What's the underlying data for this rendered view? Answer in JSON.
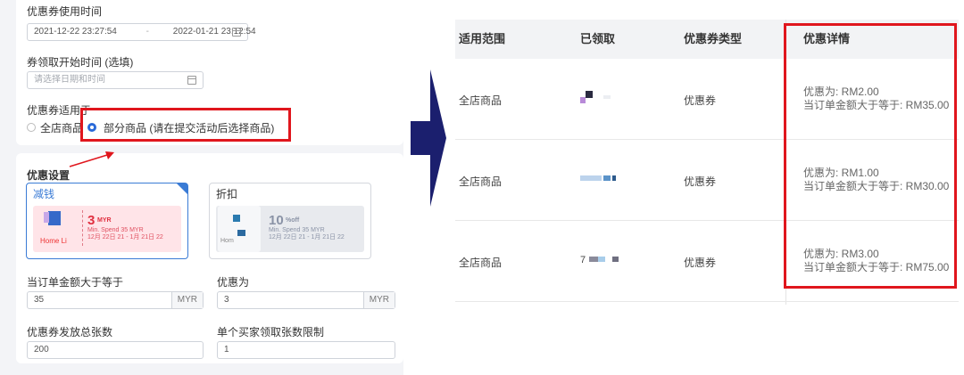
{
  "form": {
    "usage_time_label": "优惠券使用时间",
    "usage_start": "2021-12-22 23:27:54",
    "usage_sep": "-",
    "usage_end": "2022-01-21 23:12:54",
    "claim_time_label": "券领取开始时间 (选填)",
    "claim_time_placeholder": "请选择日期和时间",
    "scope_label": "优惠券适用于",
    "scope_options": [
      "全店商品",
      "部分商品 (请在提交活动后选择商品)"
    ],
    "scope_selected": 1,
    "discount_section_title": "优惠设置",
    "type_cash_label": "减钱",
    "type_percent_label": "折扣",
    "cash_voucher": {
      "amount": "3",
      "unit": "MYR",
      "min_spend": "Min. Spend 35 MYR",
      "validity": "12月 22日 21 - 1月 21日 22",
      "shop_text": "Home Li"
    },
    "percent_voucher": {
      "amount": "10",
      "unit": "%off",
      "min_spend": "Min. Spend 35 MYR",
      "validity": "12月 22日 21 - 1月 21日 22",
      "shop_text": "Hom"
    },
    "min_order_label": "当订单金额大于等于",
    "min_order_value": "35",
    "currency_suffix": "MYR",
    "discount_label": "优惠为",
    "discount_value": "3",
    "total_qty_label": "优惠券发放总张数",
    "total_qty_value": "200",
    "per_buyer_label": "单个买家领取张数限制",
    "per_buyer_value": "1"
  },
  "table": {
    "headers": [
      "适用范围",
      "已领取",
      "优惠券类型",
      "优惠详情"
    ],
    "rows": [
      {
        "scope": "全店商品",
        "claimed": "",
        "type": "优惠券",
        "detail1": "优惠为: RM2.00",
        "detail2": "当订单金额大于等于: RM35.00"
      },
      {
        "scope": "全店商品",
        "claimed": "",
        "type": "优惠券",
        "detail1": "优惠为: RM1.00",
        "detail2": "当订单金额大于等于: RM30.00"
      },
      {
        "scope": "全店商品",
        "claimed": "7",
        "type": "优惠券",
        "detail1": "优惠为: RM3.00",
        "detail2": "当订单金额大于等于: RM75.00"
      }
    ]
  },
  "colors": {
    "accent": "#2a6ad9",
    "highlight": "#e0161d",
    "arrow": "#1b1f6e",
    "voucher_pink": "#ffe4e8"
  }
}
